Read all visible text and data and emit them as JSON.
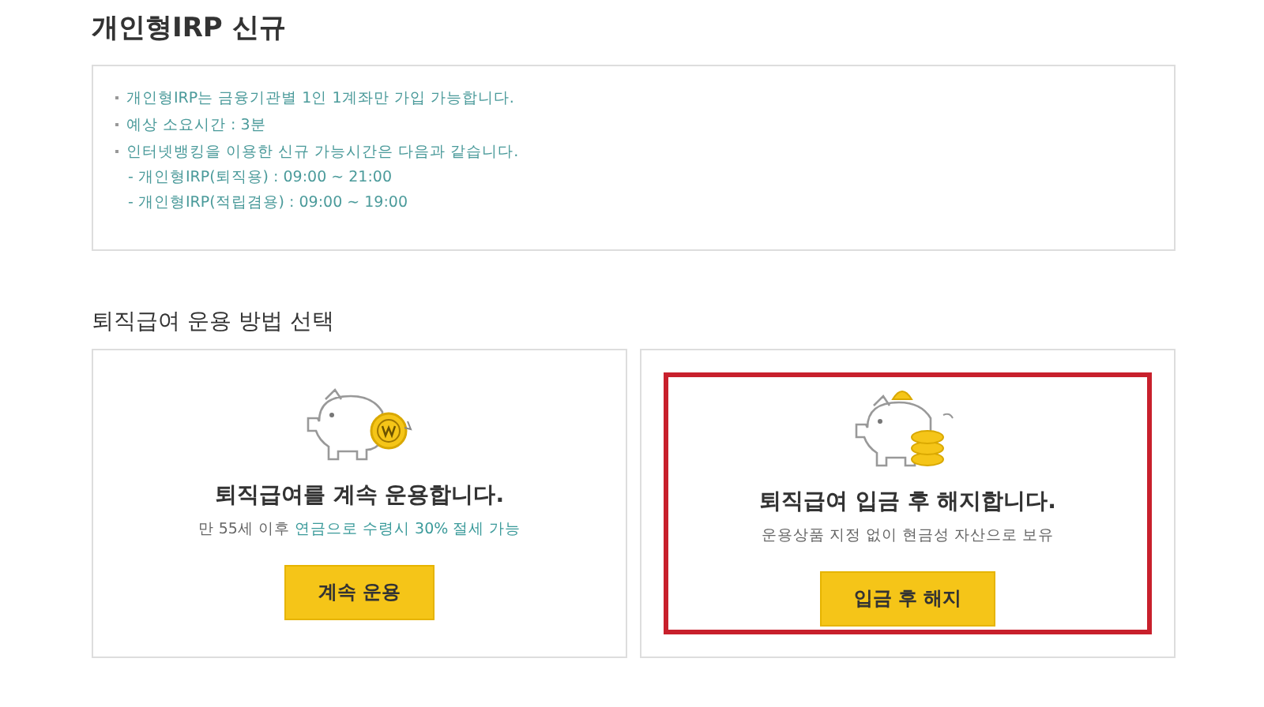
{
  "page_title": "개인형IRP 신규",
  "notices": [
    {
      "text": "개인형IRP는 금융기관별 1인 1계좌만 가입 가능합니다."
    },
    {
      "text": "예상 소요시간 : 3분"
    },
    {
      "text": "인터넷뱅킹을 이용한 신규 가능시간은 다음과 같습니다.",
      "children": [
        "- 개인형IRP(퇴직용) : 09:00 ~ 21:00",
        "- 개인형IRP(적립겸용) : 09:00 ~ 19:00"
      ]
    }
  ],
  "section_title": "퇴직급여 운용 방법 선택",
  "options": [
    {
      "kind": "piggy-coin",
      "highlighted": false,
      "title": "퇴직급여를 계속 운용합니다.",
      "note": "만 55세 이후",
      "note_highlight": "연금으로 수령시 30% 절세 가능",
      "button": "계속 운용"
    },
    {
      "kind": "piggy-stack",
      "highlighted": true,
      "title": "퇴직급여 입금 후 해지합니다.",
      "note": "운용상품 지정 없이 현금성 자산으로 보유",
      "button": "입금 후 해지"
    }
  ]
}
